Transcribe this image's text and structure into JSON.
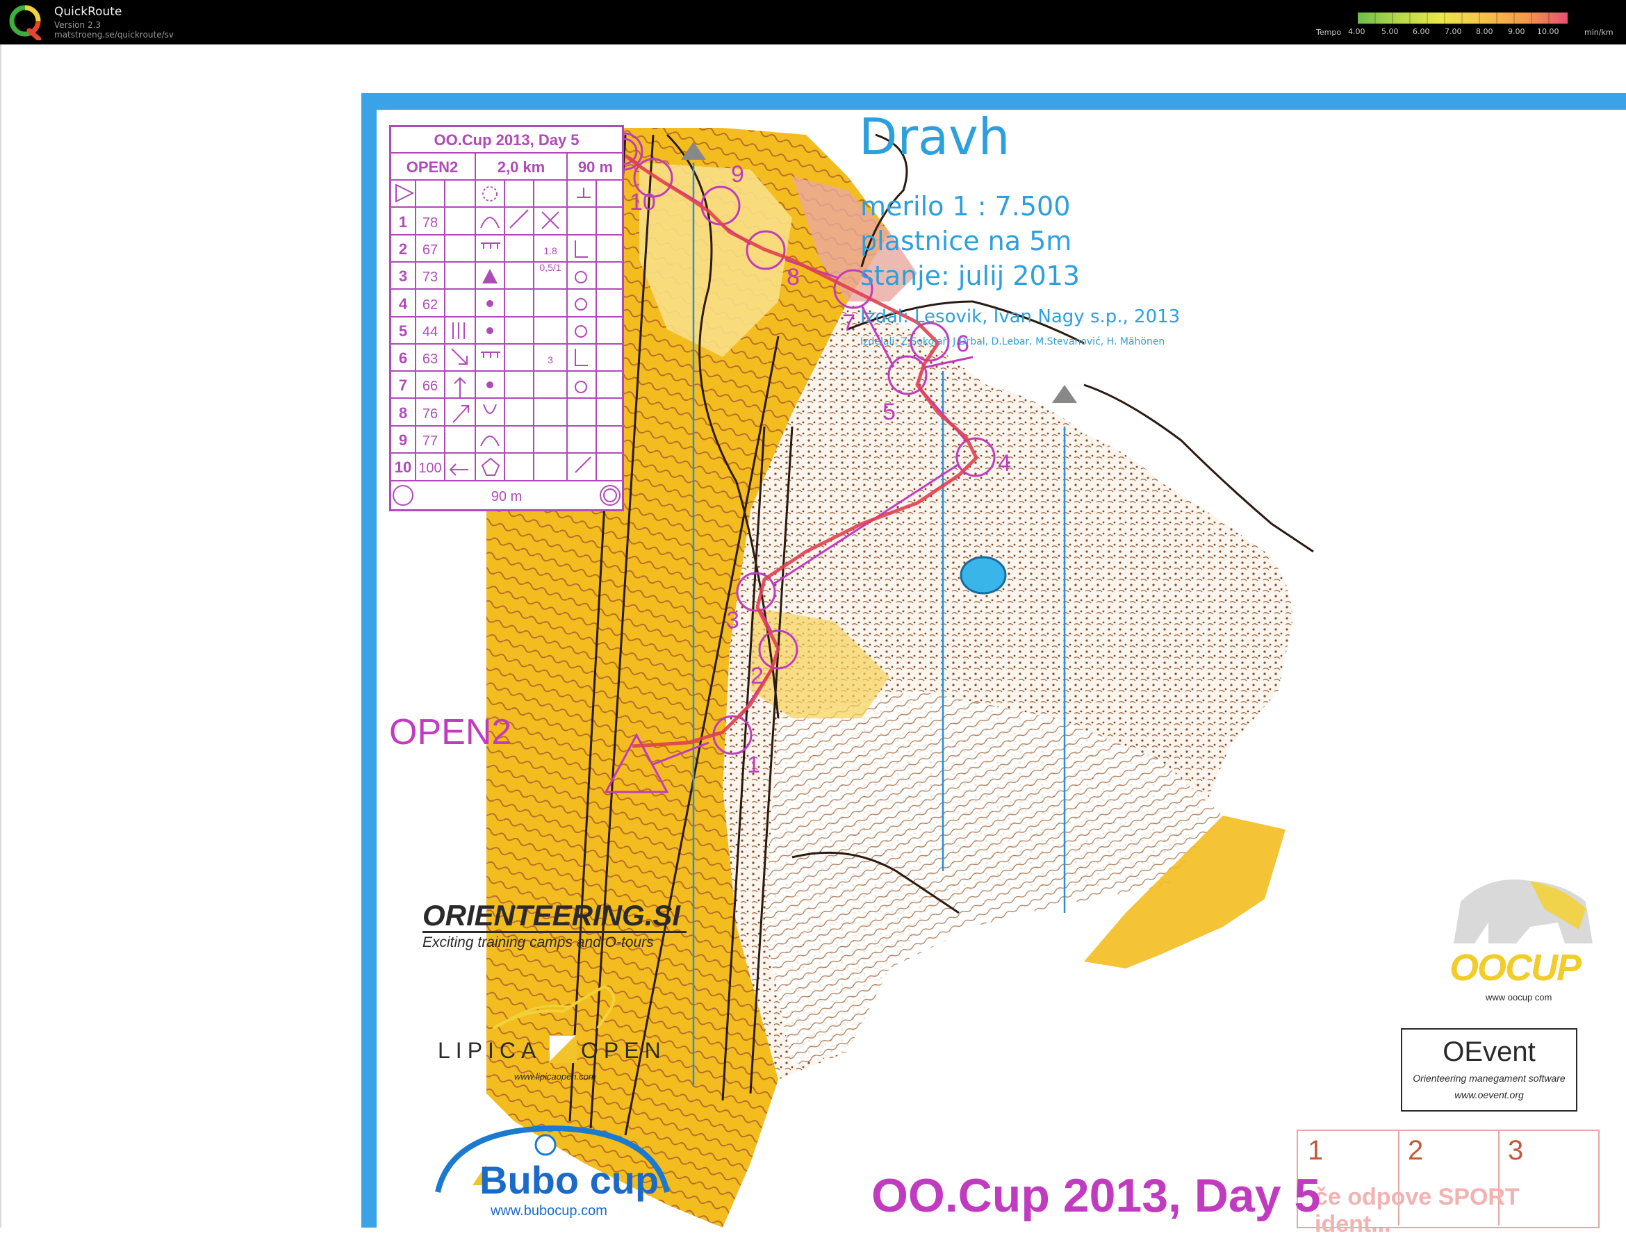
{
  "app": {
    "name": "QuickRoute",
    "version": "Version 2.3",
    "url": "matstroeng.se/quickroute/sv"
  },
  "tempo": {
    "label": "Tempo",
    "ticks": [
      "4.00",
      "5.00",
      "6.00",
      "7.00",
      "8.00",
      "9.00",
      "10.00"
    ],
    "unit": "min/km",
    "colors": [
      "#6dbf4a",
      "#b7d94a",
      "#ece84a",
      "#f6c24a",
      "#f49a4a",
      "#ef6f5a",
      "#e85070"
    ]
  },
  "map": {
    "title": "Dravh",
    "scale": "merilo 1 : 7.500",
    "contours": "plastnice na 5m",
    "state": "stanje: julij 2013",
    "publisher": "Izdal: Lesovik, Ivan Nagy s.p., 2013",
    "makers": "Izdelali: Z.Sokolař, J.Drbal, D.Lebar, M.Stevanović, H. Mähönen",
    "class_label": "OPEN2",
    "bottom_title": "OO.Cup 2013, Day 5",
    "accent_color": "#c13bc1",
    "frame_color": "#33aaee"
  },
  "control_description": {
    "event": "OO.Cup 2013, Day 5",
    "course": "OPEN2",
    "length": "2,0 km",
    "climb": "90 m",
    "rows": [
      {
        "num": "1",
        "code": "78",
        "extra": ""
      },
      {
        "num": "2",
        "code": "67",
        "extra": "1.8"
      },
      {
        "num": "3",
        "code": "73",
        "extra": "0,5/1"
      },
      {
        "num": "4",
        "code": "62",
        "extra": ""
      },
      {
        "num": "5",
        "code": "44",
        "extra": ""
      },
      {
        "num": "6",
        "code": "63",
        "extra": "3"
      },
      {
        "num": "7",
        "code": "66",
        "extra": ""
      },
      {
        "num": "8",
        "code": "76",
        "extra": ""
      },
      {
        "num": "9",
        "code": "77",
        "extra": ""
      },
      {
        "num": "10",
        "code": "100",
        "extra": ""
      }
    ],
    "finish_distance": "90 m"
  },
  "course_numbers": [
    "1",
    "2",
    "3",
    "4",
    "5",
    "6",
    "7",
    "8",
    "9",
    "10"
  ],
  "sponsors": {
    "orienteering_title": "ORIENTEERING.SI",
    "orienteering_sub": "Exciting training camps and O-tours",
    "lipica_left": "LIPICA",
    "lipica_right": "OPEN",
    "lipica_url": "www.lipicaopen.com",
    "bubo": "Bubo cup",
    "bubo_url": "www.bubocup.com",
    "oocup": "OOCUP",
    "oocup_url": "www oocup com",
    "oevent_title": "OEvent",
    "oevent_sub": "Orienteering manegament software",
    "oevent_url": "www.oevent.org"
  },
  "boxes": {
    "labels": [
      "1",
      "2",
      "3"
    ],
    "note": "če odpove SPORT ident..."
  }
}
